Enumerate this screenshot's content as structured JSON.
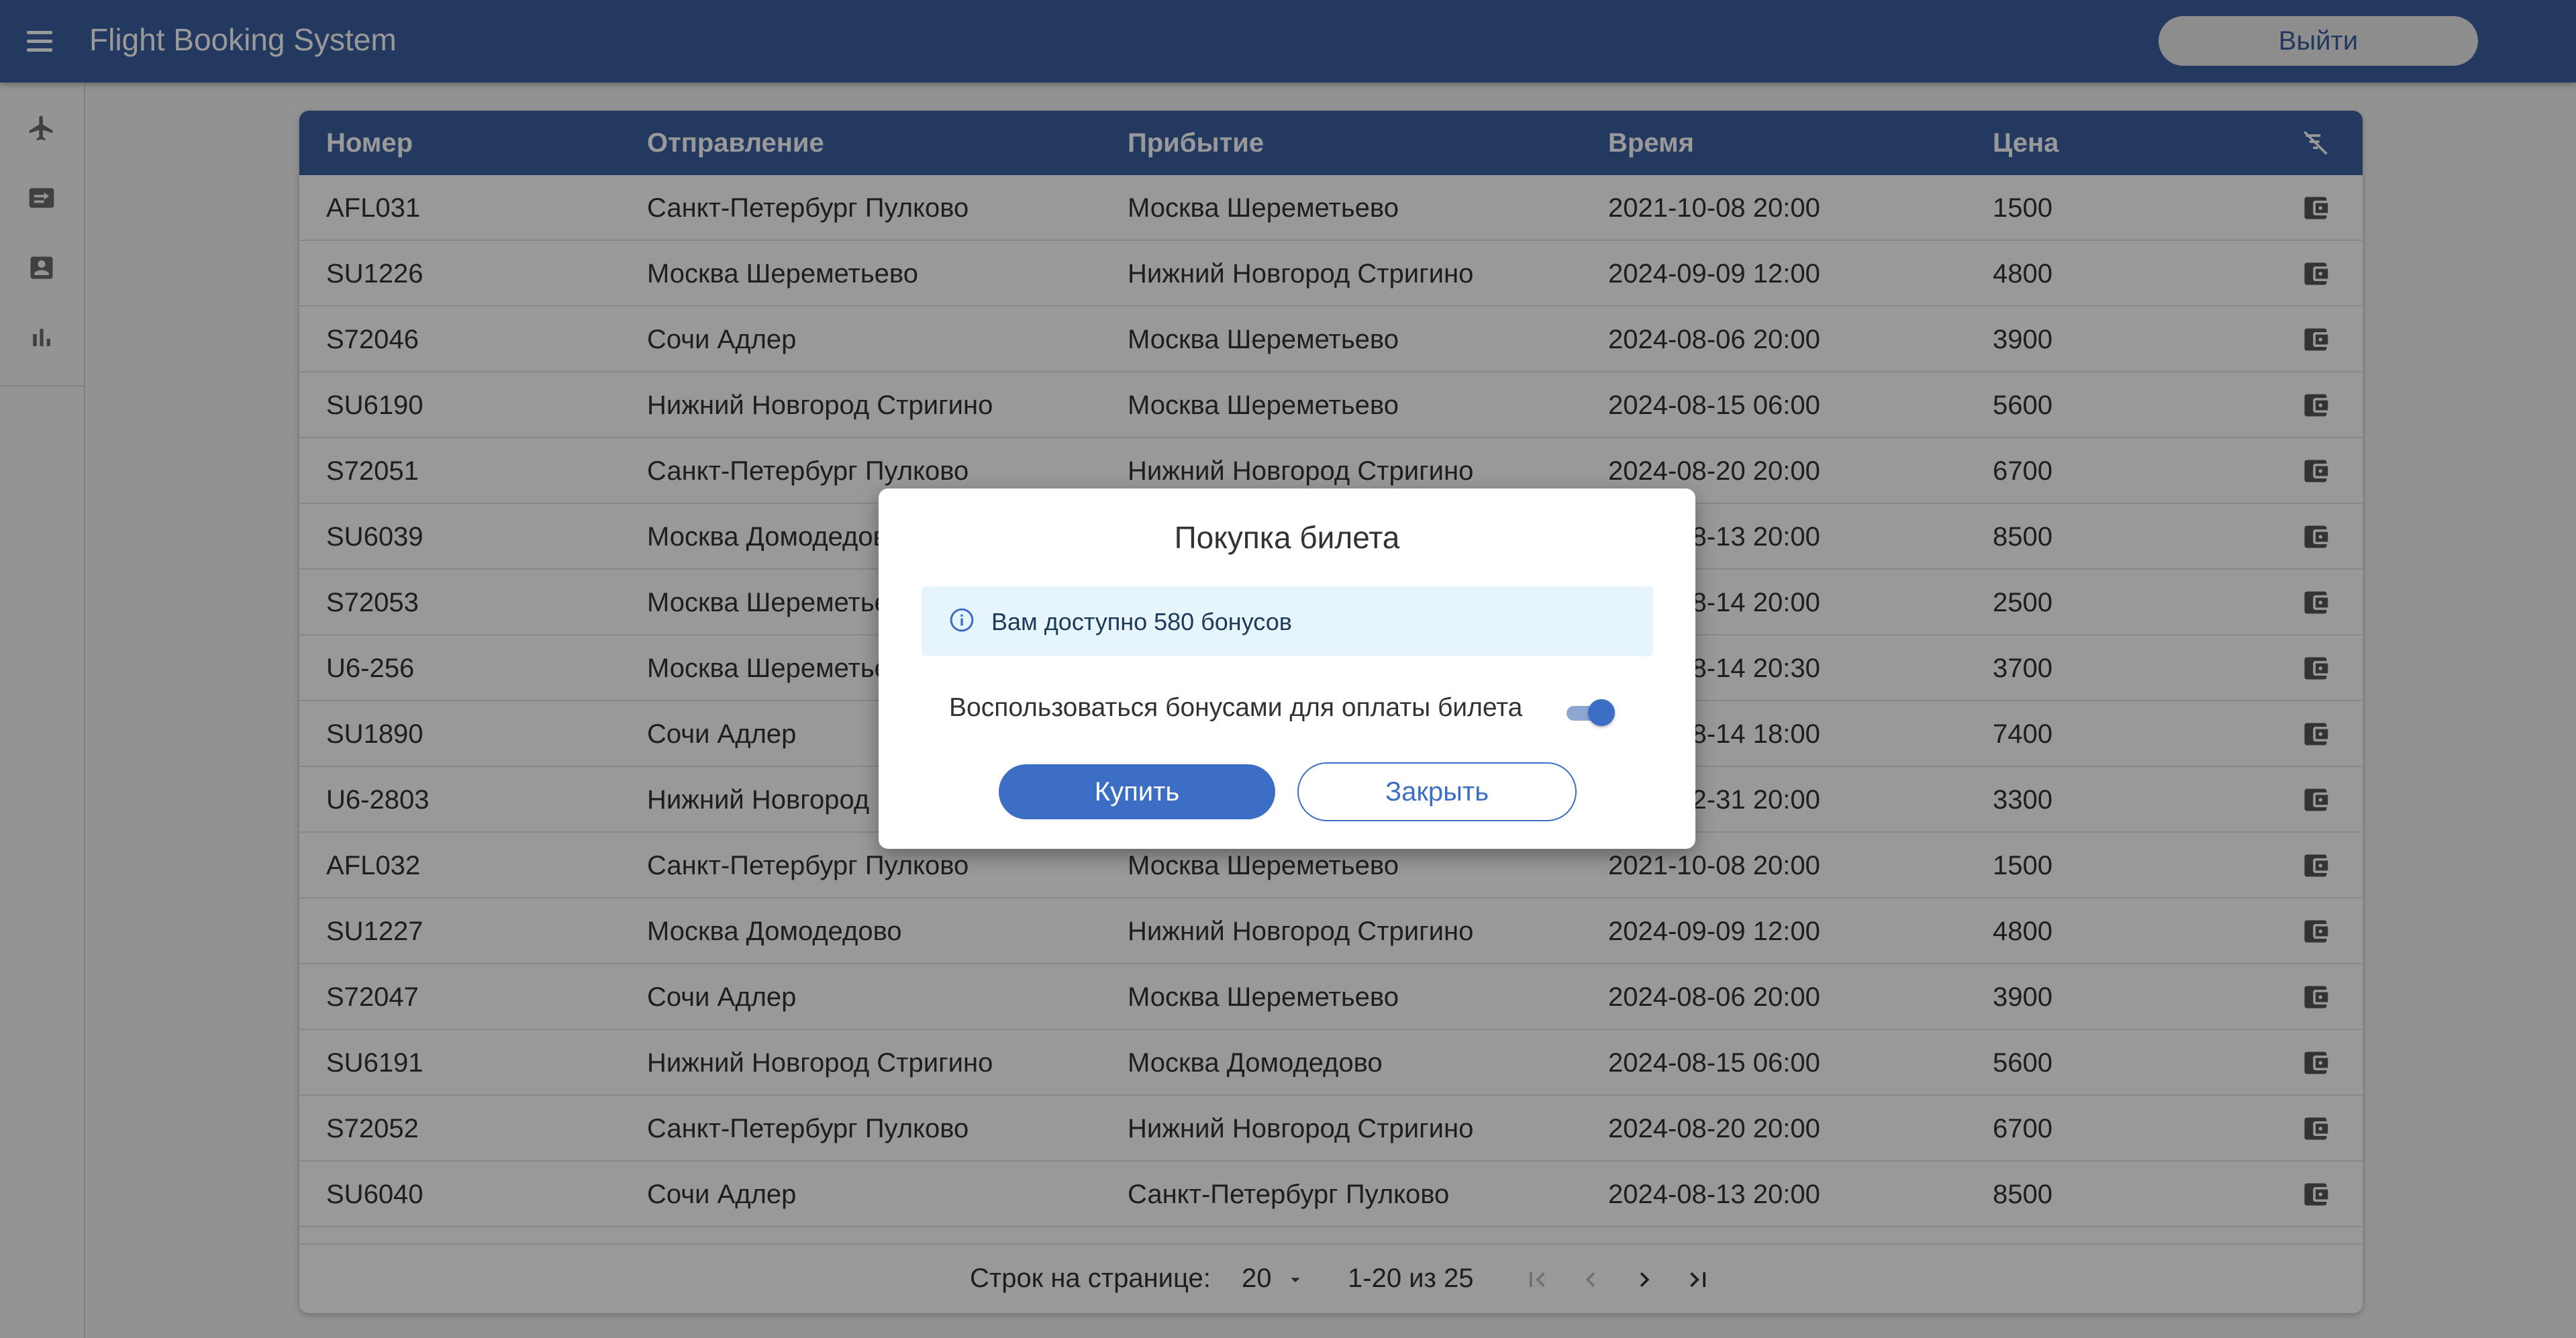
{
  "appbar": {
    "title": "Flight Booking System",
    "logout_label": "Выйти",
    "color": "#3b5f9e"
  },
  "rail": {
    "icons": [
      "airplane-icon",
      "ticket-icon",
      "profile-icon",
      "bar-chart-icon"
    ]
  },
  "table": {
    "headers": [
      "Номер",
      "Отправление",
      "Прибытие",
      "Время",
      "Цена"
    ],
    "rows": [
      [
        "AFL031",
        "Санкт-Петербург Пулково",
        "Москва Шереметьево",
        "2021-10-08 20:00",
        "1500"
      ],
      [
        "SU1226",
        "Москва Шереметьево",
        "Нижний Новгород Стригино",
        "2024-09-09 12:00",
        "4800"
      ],
      [
        "S72046",
        "Сочи Адлер",
        "Москва Шереметьево",
        "2024-08-06 20:00",
        "3900"
      ],
      [
        "SU6190",
        "Нижний Новгород Стригино",
        "Москва Шереметьево",
        "2024-08-15 06:00",
        "5600"
      ],
      [
        "S72051",
        "Санкт-Петербург Пулково",
        "Нижний Новгород Стригино",
        "2024-08-20 20:00",
        "6700"
      ],
      [
        "SU6039",
        "Москва Домодедово",
        "",
        "2024-08-13 20:00",
        "8500"
      ],
      [
        "S72053",
        "Москва Шереметьево",
        "",
        "2024-08-14 20:00",
        "2500"
      ],
      [
        "U6-256",
        "Москва Шереметьево",
        "",
        "2024-08-14 20:30",
        "3700"
      ],
      [
        "SU1890",
        "Сочи Адлер",
        "",
        "2024-08-14 18:00",
        "7400"
      ],
      [
        "U6-2803",
        "Нижний Новгород",
        "",
        "2024-12-31 20:00",
        "3300"
      ],
      [
        "AFL032",
        "Санкт-Петербург Пулково",
        "Москва Шереметьево",
        "2021-10-08 20:00",
        "1500"
      ],
      [
        "SU1227",
        "Москва Домодедово",
        "Нижний Новгород Стригино",
        "2024-09-09 12:00",
        "4800"
      ],
      [
        "S72047",
        "Сочи Адлер",
        "Москва Шереметьево",
        "2024-08-06 20:00",
        "3900"
      ],
      [
        "SU6191",
        "Нижний Новгород Стригино",
        "Москва Домодедово",
        "2024-08-15 06:00",
        "5600"
      ],
      [
        "S72052",
        "Санкт-Петербург Пулково",
        "Нижний Новгород Стригино",
        "2024-08-20 20:00",
        "6700"
      ],
      [
        "SU6040",
        "Сочи Адлер",
        "Санкт-Петербург Пулково",
        "2024-08-13 20:00",
        "8500"
      ]
    ]
  },
  "pagination": {
    "rows_per_page_label": "Строк на странице:",
    "rows_per_page": "20",
    "range": "1-20 из 25"
  },
  "dialog": {
    "title": "Покупка билета",
    "alert": "Вам доступно 580 бонусов",
    "switch_label": "Воспользоваться бонусами для оплаты билета",
    "switch_on": true,
    "buy_label": "Купить",
    "close_label": "Закрыть",
    "accent": "#3b6ec4"
  }
}
